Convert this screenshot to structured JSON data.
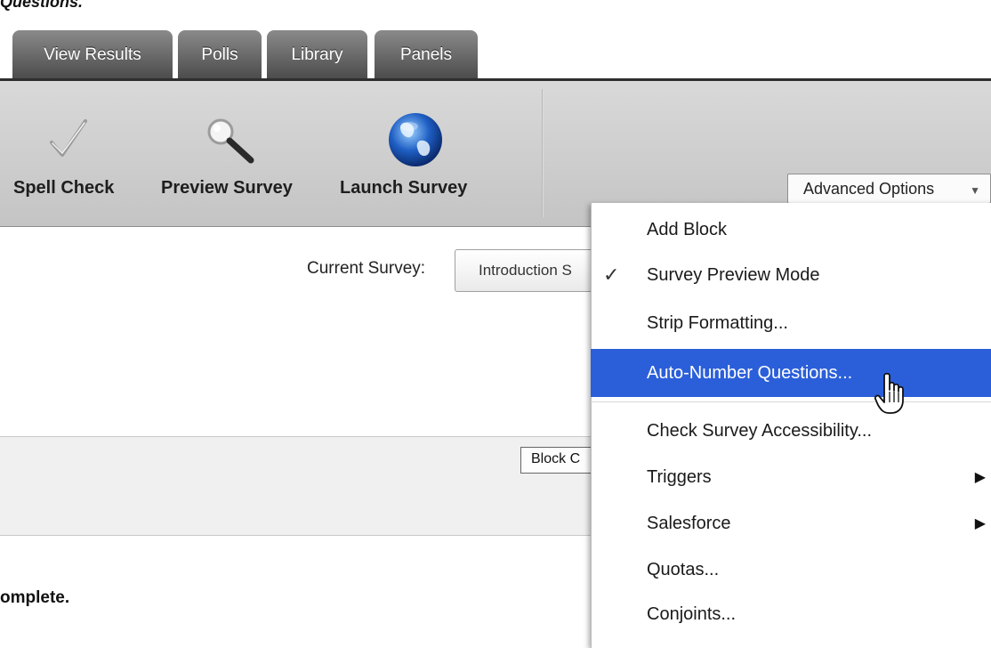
{
  "caption": "Questions.",
  "tabs": [
    {
      "label": "View Results"
    },
    {
      "label": "Polls"
    },
    {
      "label": "Library"
    },
    {
      "label": "Panels"
    }
  ],
  "toolbar": {
    "spell_check": "Spell Check",
    "preview_survey": "Preview Survey",
    "launch_survey": "Launch Survey",
    "advanced_options": "Advanced Options"
  },
  "content": {
    "current_survey_label": "Current Survey:",
    "current_survey_value": "Introduction S",
    "block_button": "Block C",
    "complete_text": "omplete."
  },
  "menu": {
    "items": [
      {
        "label": "Add Block"
      },
      {
        "label": "Survey Preview Mode",
        "checked": true
      },
      {
        "label": "Strip Formatting..."
      },
      {
        "label": "Auto-Number Questions...",
        "highlighted": true
      },
      {
        "label": "Check Survey Accessibility..."
      },
      {
        "label": "Triggers",
        "submenu": true
      },
      {
        "label": "Salesforce",
        "submenu": true
      },
      {
        "label": "Quotas..."
      },
      {
        "label": "Conjoints..."
      }
    ]
  },
  "colors": {
    "highlight": "#2b5fd9",
    "tab_dark": "#4a4a4a",
    "globe_blue": "#1f5fc4"
  },
  "icons": {
    "check": "checkmark-icon",
    "magnifier": "magnifier-icon",
    "globe": "globe-icon",
    "cursor": "hand-cursor-icon"
  }
}
